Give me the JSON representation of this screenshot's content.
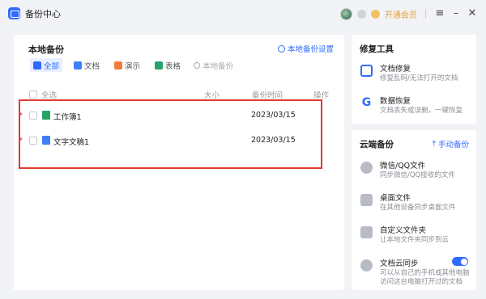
{
  "app": {
    "title": "备份中心"
  },
  "titlebar": {
    "vip_label": "开通会员"
  },
  "main": {
    "title": "本地备份",
    "settings_label": "本地备份设置",
    "filters": [
      "全部",
      "文档",
      "演示",
      "表格"
    ],
    "search_placeholder": "本地备份",
    "columns": {
      "select_all": "全选",
      "size": "大小",
      "time": "备份时间",
      "action": "操作"
    },
    "rows": [
      {
        "name": "工作簿1",
        "type": "sheet",
        "time": "2023/03/15"
      },
      {
        "name": "文字文稿1",
        "type": "word",
        "time": "2023/03/15"
      }
    ]
  },
  "repair": {
    "title": "修复工具",
    "items": [
      {
        "title": "文档修复",
        "desc": "修复乱码/无法打开的文档",
        "icon": "repair-icon"
      },
      {
        "title": "数据恢复",
        "desc": "文档丢失或误删，一键恢复",
        "icon": "recovery-icon"
      }
    ]
  },
  "cloud": {
    "title": "云端备份",
    "manual_label": "手动备份",
    "items": [
      {
        "title": "微信/QQ文件",
        "desc": "同步微信/QQ接收的文件",
        "icon": "wechat-qq-icon"
      },
      {
        "title": "桌面文件",
        "desc": "在其他设备同步桌面文件",
        "icon": "desktop-icon"
      },
      {
        "title": "自定义文件夹",
        "desc": "让本地文件夹同步到云",
        "icon": "folder-icon"
      },
      {
        "title": "文档云同步",
        "desc": "可以从自己的手机或其他电脑",
        "desc2": "访问这台电脑打开过的文档",
        "icon": "cloud-sync-icon",
        "toggle_on": true
      }
    ]
  },
  "colors": {
    "accent": "#2f6bff",
    "highlight": "#e03a2f",
    "vip": "#e2a23a"
  }
}
